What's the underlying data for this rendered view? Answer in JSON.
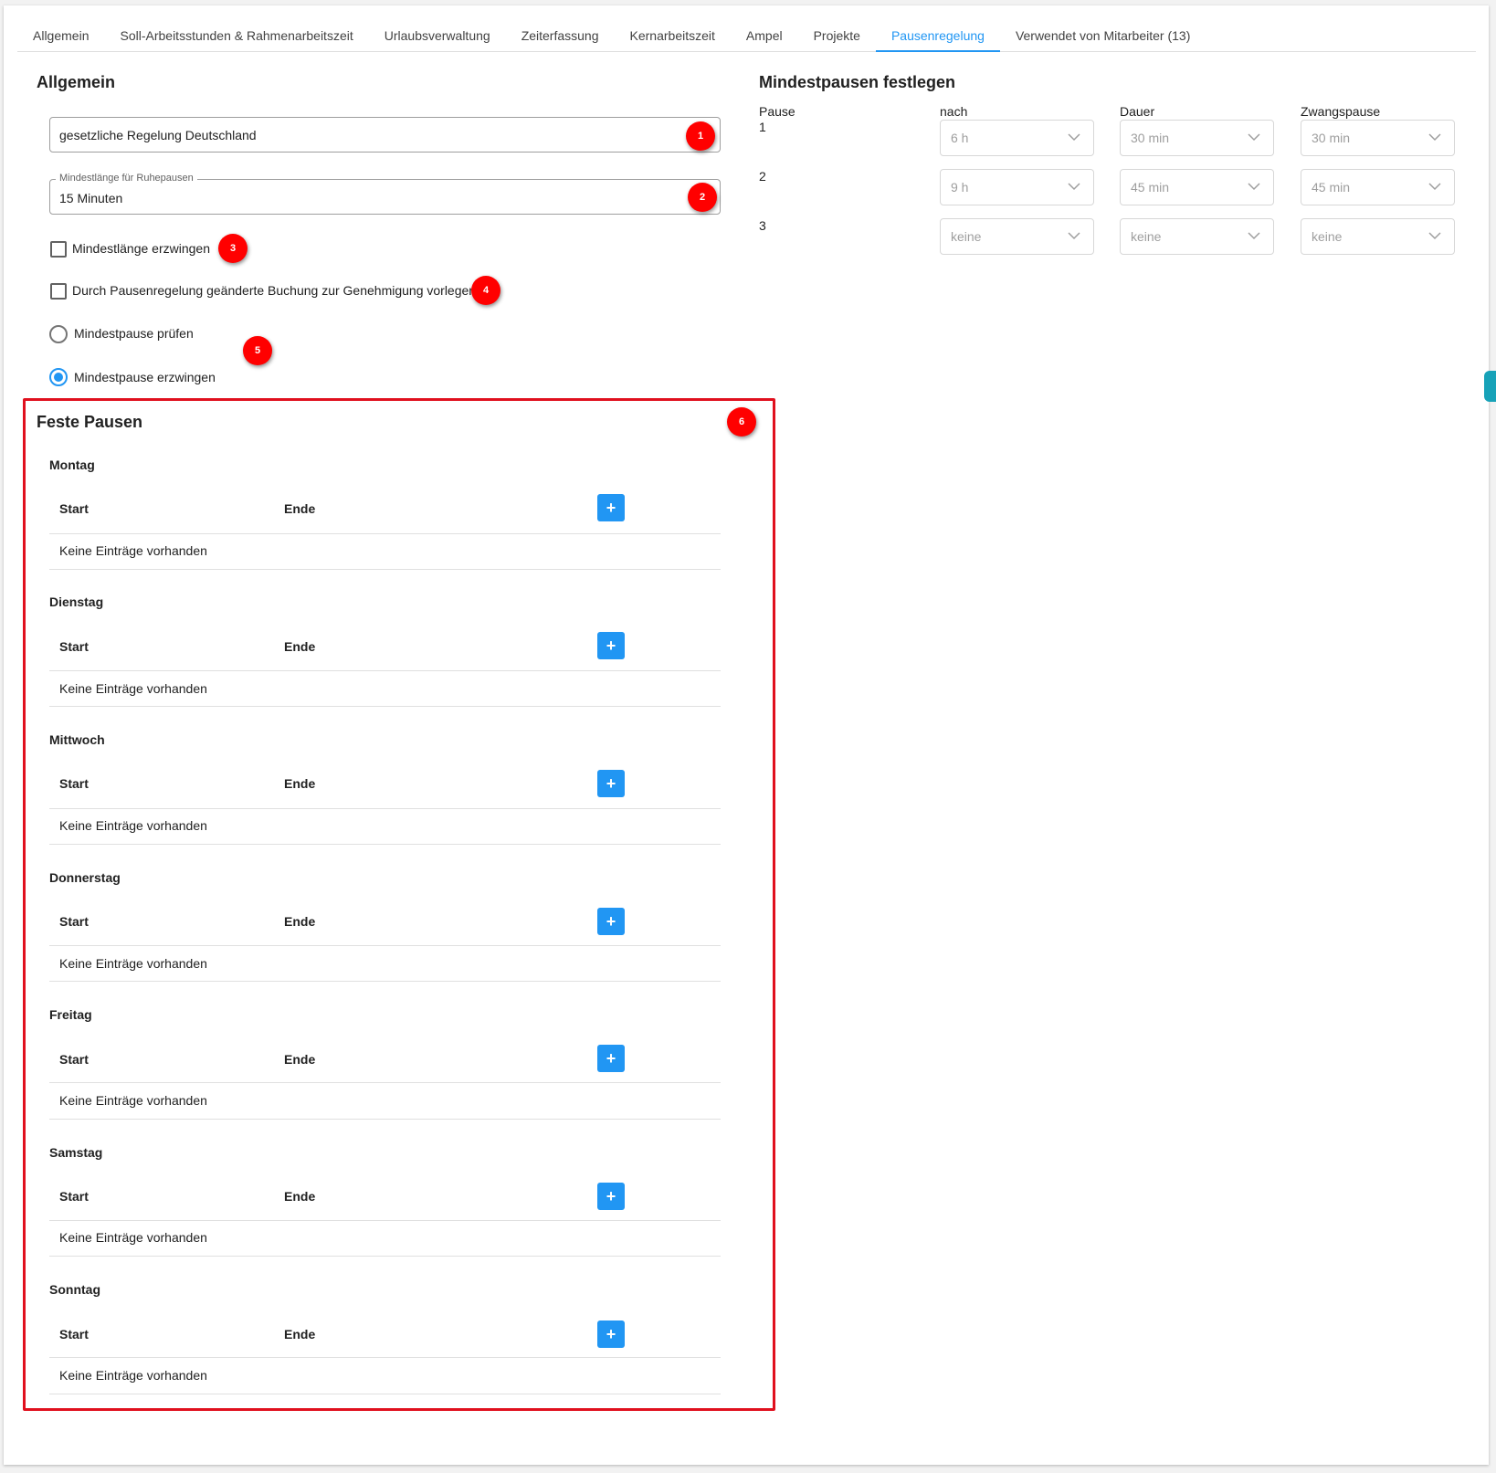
{
  "tabs": [
    {
      "label": "Allgemein"
    },
    {
      "label": "Soll-Arbeitsstunden & Rahmenarbeitszeit"
    },
    {
      "label": "Urlaubsverwaltung"
    },
    {
      "label": "Zeiterfassung"
    },
    {
      "label": "Kernarbeitszeit"
    },
    {
      "label": "Ampel"
    },
    {
      "label": "Projekte"
    },
    {
      "label": "Pausenregelung",
      "active": true
    },
    {
      "label": "Verwendet von Mitarbeiter (13)"
    }
  ],
  "general": {
    "heading": "Allgemein",
    "rule_value": "gesetzliche Regelung Deutschland",
    "min_length_legend": "Mindestlänge für Ruhepausen",
    "min_length_value": "15 Minuten",
    "enforce_min_length": "Mindestlänge erzwingen",
    "submit_for_approval": "Durch Pausenregelung geänderte Buchung zur Genehmigung vorlegen",
    "radio_check": "Mindestpause prüfen",
    "radio_enforce": "Mindestpause erzwingen",
    "radio_selected": "Mindestpause erzwingen"
  },
  "badges": [
    "1",
    "2",
    "3",
    "4",
    "5",
    "6"
  ],
  "min_breaks": {
    "heading": "Mindestpausen festlegen",
    "col_pause": "Pause",
    "col_after": "nach",
    "col_duration": "Dauer",
    "col_forced": "Zwangspause",
    "rows": [
      {
        "num": "1",
        "after": "6 h",
        "duration": "30 min",
        "forced": "30 min"
      },
      {
        "num": "2",
        "after": "9 h",
        "duration": "45 min",
        "forced": "45 min"
      },
      {
        "num": "3",
        "after": "keine",
        "duration": "keine",
        "forced": "keine"
      }
    ]
  },
  "fixed_breaks": {
    "heading": "Feste Pausen",
    "col_start": "Start",
    "col_end": "Ende",
    "add_label": "+",
    "empty_text": "Keine Einträge vorhanden",
    "days": [
      "Montag",
      "Dienstag",
      "Mittwoch",
      "Donnerstag",
      "Freitag",
      "Samstag",
      "Sonntag"
    ]
  },
  "colors": {
    "accent": "#2196f3",
    "annotation": "#ff0000",
    "highlight": "#e0101e"
  }
}
